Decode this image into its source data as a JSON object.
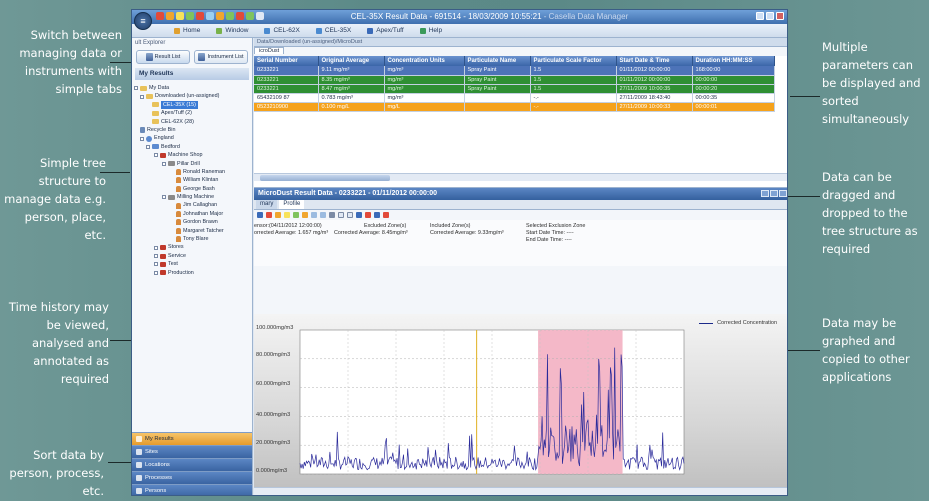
{
  "callouts": {
    "left": [
      {
        "text": "Switch between managing data or instruments with simple tabs"
      },
      {
        "text": "Simple tree structure to manage data e.g. person, place, etc."
      },
      {
        "text": "Time history may be viewed, analysed and annotated as required"
      },
      {
        "text": "Sort data by person, process, etc."
      }
    ],
    "right": [
      {
        "text": "Multiple parameters can be displayed and sorted simultaneously"
      },
      {
        "text": "Data can be dragged and dropped to the tree structure as required"
      },
      {
        "text": "Data may be graphed and copied to other applications"
      }
    ]
  },
  "window": {
    "title": "CEL-35X Result Data - 691514 - 18/03/2009 10:55:21",
    "app_name": " - Casella Data Manager",
    "ribbon_tabs": [
      "Home",
      "Window",
      "CEL-62X",
      "CEL-35X",
      "Apex/Tuff",
      "Help"
    ]
  },
  "explorer": {
    "pane_title": "ult Explorer",
    "result_list_tab": "Result List",
    "instrument_list_tab": "Instrument List",
    "my_results_header": "My Results",
    "tree": [
      "My Data",
      "Downloaded (un-assigned)",
      "CEL-35X (15)",
      "Apex/Tuff (2)",
      "CEL-62X (28)",
      "Recycle Bin",
      "England",
      "Bedford",
      "Machine Shop",
      "Pillar Drill",
      "Ronald Raneman",
      "William Klintan",
      "George Bash",
      "Milling Machine",
      "Jim Callaghan",
      "Johnathan Major",
      "Gordon Brawn",
      "Margaret Tatcher",
      "Tony Blare",
      "Stores",
      "Service",
      "Test",
      "Production"
    ],
    "nav_buttons": [
      "My Results",
      "Sites",
      "Locations",
      "Processes",
      "Persons"
    ]
  },
  "grid": {
    "breadcrumb": "Data/Downloaded (un-assigned)/MicroDust",
    "tab": "icroDust",
    "columns": [
      "Serial Number",
      "Original Average",
      "Concentration Units",
      "Particulate Name",
      "Particulate Scale Factor",
      "Start Date & Time",
      "Duration HH:MM:SS"
    ],
    "rows": [
      [
        "0233221",
        "9.11 mg/m³",
        "mg/m³",
        "Spray Paint",
        "1.5",
        "01/11/2012 00:00:00",
        "168:00:00"
      ],
      [
        "0233221",
        "8.35 mg/m³",
        "mg/m³",
        "Spray Paint",
        "1.5",
        "01/11/2012 00:00:00",
        "00:00:00"
      ],
      [
        "0233221",
        "8.47 mg/m³",
        "mg/m³",
        "Spray Paint",
        "1.5",
        "27/11/2009 10:00:35",
        "00:00:20"
      ],
      [
        "65432109 87",
        "0.783 mg/m³",
        "mg/m³",
        "",
        "-.-",
        "27/11/2009 18:43:40",
        "00:00:35"
      ],
      [
        "0523210900",
        "0.100 mg/L",
        "mg/L",
        "",
        "-.-",
        "27/11/2009 10:00:33",
        "00:00:01"
      ]
    ]
  },
  "result": {
    "title": "MicroDust Result Data - 0233221 - 01/11/2012 00:00:00",
    "tabs": [
      "mary",
      "Profile"
    ],
    "info": {
      "line1a": "ensor:(04/11/2012 12:00:00)",
      "line1b": "orrected Average: 1.657 mg/m³",
      "excl_a": "Excluded Zone(s)",
      "excl_b": "Corrected Average: 8.45mg/m³",
      "incl_a": "Included Zone(s)",
      "incl_b": "Corrected Average: 9.33mg/m³",
      "sel_a": "Selected Exclusion Zone",
      "sel_b": "Start Date Time: ----",
      "sel_c": "End Date Time: ----"
    }
  },
  "chart_data": {
    "type": "line",
    "title": "",
    "xlabel": "",
    "ylabel": "",
    "ylim": [
      0,
      100
    ],
    "y_ticks": [
      "0.000mg/m3",
      "20.000mg/m3",
      "40.000mg/m3",
      "60.000mg/m3",
      "80.000mg/m3",
      "100.000mg/m3"
    ],
    "series": [
      {
        "name": "Corrected Concentration",
        "color": "#2a2a9a"
      }
    ],
    "exclusion_zone": {
      "x_start": 0.62,
      "x_end": 0.84,
      "color": "#f4b8c8"
    },
    "marker_line": {
      "x": 0.46,
      "color": "#e0b020"
    }
  }
}
